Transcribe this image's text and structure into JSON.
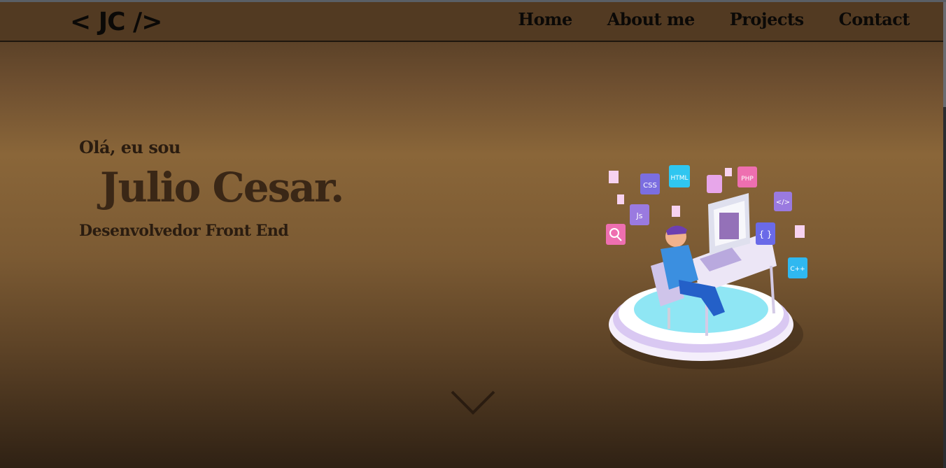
{
  "navbar": {
    "logo": "< JC />",
    "links": [
      "Home",
      "About me",
      "Projects",
      "Contact"
    ]
  },
  "hero": {
    "greeting": "Olá, eu sou",
    "name": "Julio Cesar.",
    "role": "Desenvolvedor Front End"
  },
  "illustration": {
    "tags": [
      "CSS",
      "HTML",
      "PHP",
      "Js",
      "</>",
      "{ }",
      "C++"
    ]
  },
  "icons": {
    "scroll_down": "chevron-down-icon"
  },
  "colors": {
    "navbar_bg": "#523a22",
    "hero_bg_mid": "#8a6639",
    "text_dark": "#2a1c10",
    "tag_purple": "#7b6ee0",
    "tag_cyan": "#2fc6f0",
    "tag_pink": "#ee6fb0"
  }
}
